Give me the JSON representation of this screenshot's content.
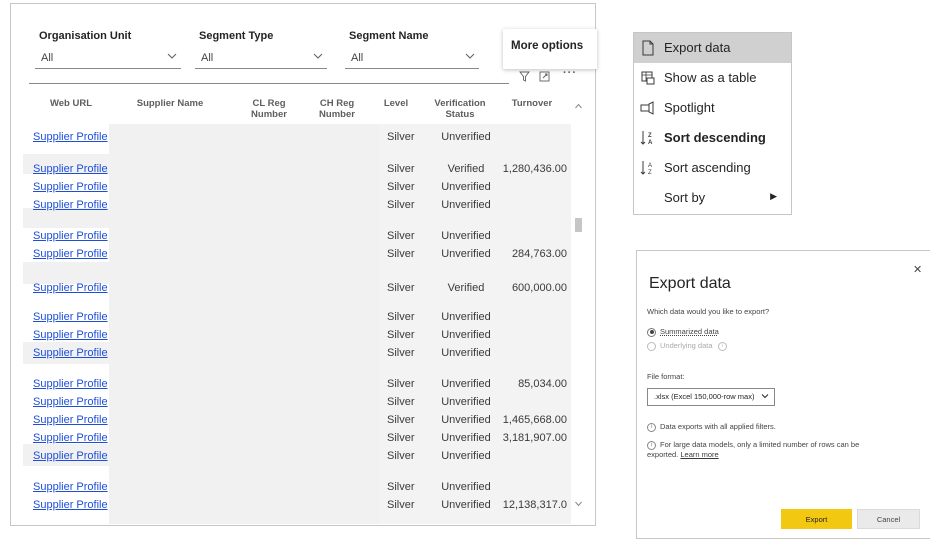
{
  "filters": [
    {
      "label": "Organisation Unit",
      "value": "All"
    },
    {
      "label": "Segment Type",
      "value": "All"
    },
    {
      "label": "Segment Name",
      "value": "All"
    }
  ],
  "more_options_tooltip": "More options",
  "toolbar_icons": [
    "filter-icon",
    "focus-mode-icon",
    "more-options-icon"
  ],
  "table": {
    "columns": [
      "Web URL",
      "Supplier Name",
      "CL Reg Number",
      "CH Reg Number",
      "Level",
      "Verification Status",
      "Turnover"
    ],
    "rows": [
      {
        "url": "Supplier Profile",
        "level": "Silver",
        "status": "Unverified",
        "turnover": ""
      },
      {
        "url": "Supplier Profile",
        "level": "Silver",
        "status": "Verified",
        "turnover": "1,280,436.00"
      },
      {
        "url": "Supplier Profile",
        "level": "Silver",
        "status": "Unverified",
        "turnover": ""
      },
      {
        "url": "Supplier Profile",
        "level": "Silver",
        "status": "Unverified",
        "turnover": ""
      },
      {
        "url": "Supplier Profile",
        "level": "Silver",
        "status": "Unverified",
        "turnover": ""
      },
      {
        "url": "Supplier Profile",
        "level": "Silver",
        "status": "Unverified",
        "turnover": "284,763.00"
      },
      {
        "url": "Supplier Profile",
        "level": "Silver",
        "status": "Verified",
        "turnover": "600,000.00"
      },
      {
        "url": "Supplier Profile",
        "level": "Silver",
        "status": "Unverified",
        "turnover": ""
      },
      {
        "url": "Supplier Profile",
        "level": "Silver",
        "status": "Unverified",
        "turnover": ""
      },
      {
        "url": "Supplier Profile",
        "level": "Silver",
        "status": "Unverified",
        "turnover": ""
      },
      {
        "url": "Supplier Profile",
        "level": "Silver",
        "status": "Unverified",
        "turnover": "85,034.00"
      },
      {
        "url": "Supplier Profile",
        "level": "Silver",
        "status": "Unverified",
        "turnover": ""
      },
      {
        "url": "Supplier Profile",
        "level": "Silver",
        "status": "Unverified",
        "turnover": "1,465,668.00"
      },
      {
        "url": "Supplier Profile",
        "level": "Silver",
        "status": "Unverified",
        "turnover": "3,181,907.00"
      },
      {
        "url": "Supplier Profile",
        "level": "Silver",
        "status": "Unverified",
        "turnover": ""
      },
      {
        "url": "Supplier Profile",
        "level": "Silver",
        "status": "Unverified",
        "turnover": ""
      },
      {
        "url": "Supplier Profile",
        "level": "Silver",
        "status": "Unverified",
        "turnover": "12,138,317.0"
      }
    ]
  },
  "context_menu": {
    "items": [
      {
        "label": "Export data",
        "icon": "export-icon"
      },
      {
        "label": "Show as a table",
        "icon": "table-icon"
      },
      {
        "label": "Spotlight",
        "icon": "spotlight-icon"
      },
      {
        "label": "Sort descending",
        "icon": "sort-descending-icon"
      },
      {
        "label": "Sort ascending",
        "icon": "sort-ascending-icon"
      },
      {
        "label": "Sort by",
        "icon": ""
      }
    ]
  },
  "export_dialog": {
    "title": "Export data",
    "question": "Which data would you like to export?",
    "options": [
      {
        "label": "Summarized data",
        "selected": true,
        "enabled": true
      },
      {
        "label": "Underlying data",
        "selected": false,
        "enabled": false
      }
    ],
    "file_format_label": "File format:",
    "file_format_value": ".xlsx (Excel 150,000-row max)",
    "info_1": "Data exports with all applied filters.",
    "info_2": "For large data models, only a limited number of rows can be exported.",
    "learn_more": "Learn more",
    "export_label": "Export",
    "cancel_label": "Cancel"
  },
  "colors": {
    "accent": "#f2c811",
    "link": "#1d4ed8",
    "menu_highlight": "#d0d0d0"
  }
}
